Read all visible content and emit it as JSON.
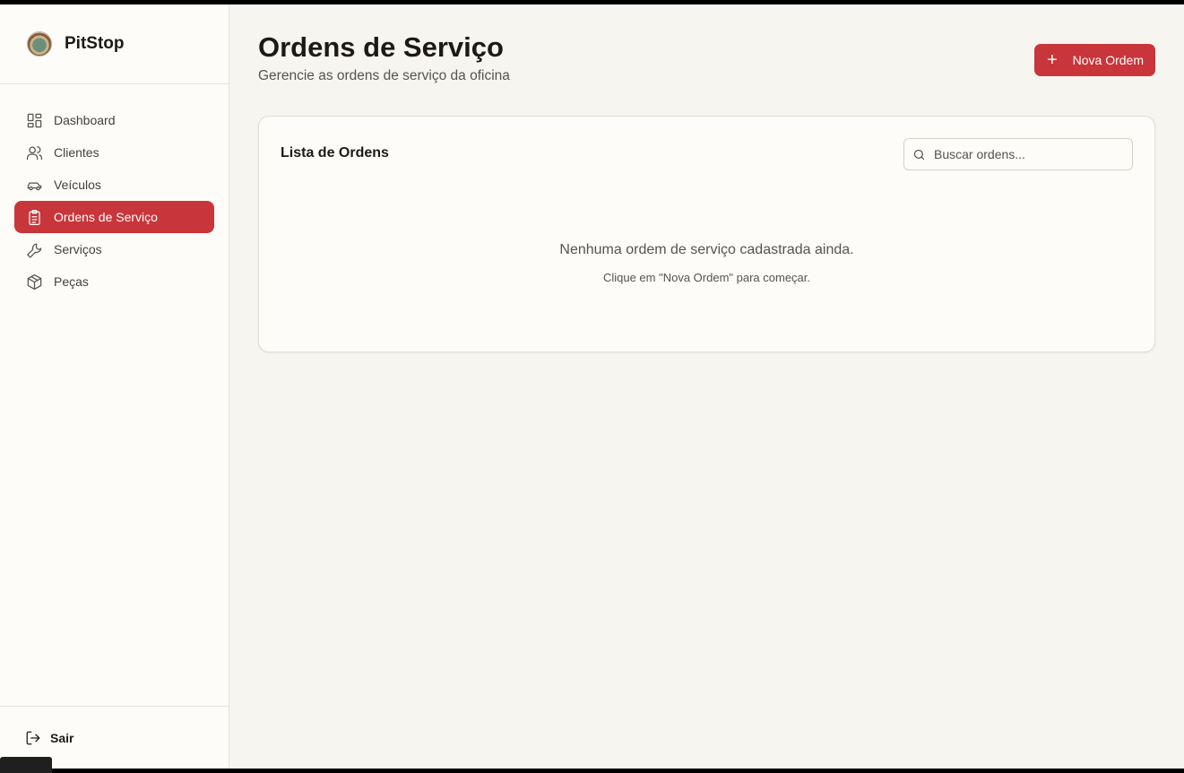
{
  "brand": {
    "name": "PitStop"
  },
  "sidebar": {
    "items": [
      {
        "label": "Dashboard",
        "icon": "dashboard-icon",
        "active": false
      },
      {
        "label": "Clientes",
        "icon": "users-icon",
        "active": false
      },
      {
        "label": "Veículos",
        "icon": "car-icon",
        "active": false
      },
      {
        "label": "Ordens de Serviço",
        "icon": "clipboard-icon",
        "active": true
      },
      {
        "label": "Serviços",
        "icon": "wrench-icon",
        "active": false
      },
      {
        "label": "Peças",
        "icon": "package-icon",
        "active": false
      }
    ],
    "logout_label": "Sair"
  },
  "header": {
    "title": "Ordens de Serviço",
    "subtitle": "Gerencie as ordens de serviço da oficina",
    "new_button_label": "Nova Ordem"
  },
  "card": {
    "title": "Lista de Ordens",
    "search_placeholder": "Buscar ordens...",
    "empty_message": "Nenhuma ordem de serviço cadastrada ainda.",
    "empty_hint": "Clique em \"Nova Ordem\" para começar."
  },
  "colors": {
    "accent": "#c8353a",
    "background": "#f7f5f0",
    "sidebar": "#fdfcf9"
  }
}
